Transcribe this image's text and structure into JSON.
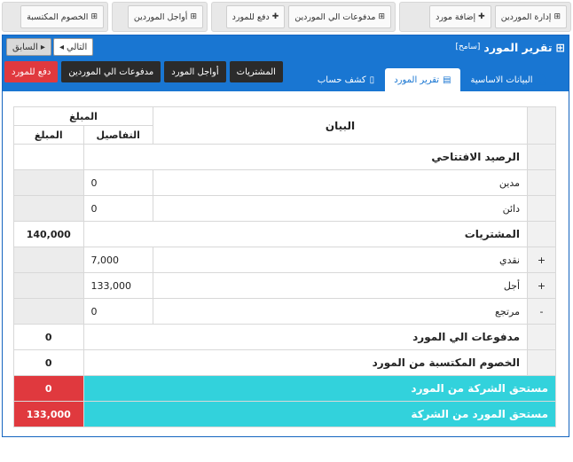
{
  "top_buttons": {
    "group1": [
      {
        "label": "إدارة الموردين",
        "icon": "grid-icon"
      },
      {
        "label": "إضافة مورد",
        "icon": "plus-icon"
      }
    ],
    "group2": [
      {
        "label": "مدفوعات الي الموردين",
        "icon": "grid-icon"
      },
      {
        "label": "دفع للمورد",
        "icon": "plus-icon"
      }
    ],
    "group3": [
      {
        "label": "أواجل الموردين",
        "icon": "grid-icon"
      }
    ],
    "group4": [
      {
        "label": "الخصوم المكتسبة",
        "icon": "grid-icon"
      }
    ]
  },
  "panel": {
    "title": "تقرير المورد",
    "subtitle": "[سامح]",
    "nav_next": "التالي",
    "nav_prev": "السابق"
  },
  "tabs": [
    {
      "label": "البيانات الاساسية",
      "icon": "user-icon"
    },
    {
      "label": "تقرير المورد",
      "icon": "chart-icon"
    },
    {
      "label": "كشف حساب",
      "icon": "document-icon"
    }
  ],
  "actions": {
    "purchases": "المشتريات",
    "supplier_deferred": "أواجل المورد",
    "payments_to_suppliers": "مدفوعات الي الموردين",
    "pay_supplier": "دفع للمورد"
  },
  "table": {
    "header_desc": "البيان",
    "header_amount": "المبلغ",
    "header_details": "التفاصيل",
    "header_amount2": "المبلغ",
    "opening_balance": "الرصيد الافتتاحي",
    "debit_label": "مدين",
    "debit_value": "0",
    "credit_label": "دائن",
    "credit_value": "0",
    "purchases_label": "المشتريات",
    "purchases_total": "140,000",
    "cash_sign": "+",
    "cash_label": "نقدي",
    "cash_value": "7,000",
    "deferred_sign": "+",
    "deferred_label": "أجل",
    "deferred_value": "133,000",
    "return_sign": "-",
    "return_label": "مرتجع",
    "return_value": "0",
    "payments_label": "مدفوعات الي المورد",
    "payments_value": "0",
    "discounts_label": "الخصوم المكتسبة من المورد",
    "discounts_value": "0",
    "company_due_label": "مستحق الشركة من المورد",
    "company_due_value": "0",
    "supplier_due_label": "مستحق المورد من الشركة",
    "supplier_due_value": "133,000"
  }
}
